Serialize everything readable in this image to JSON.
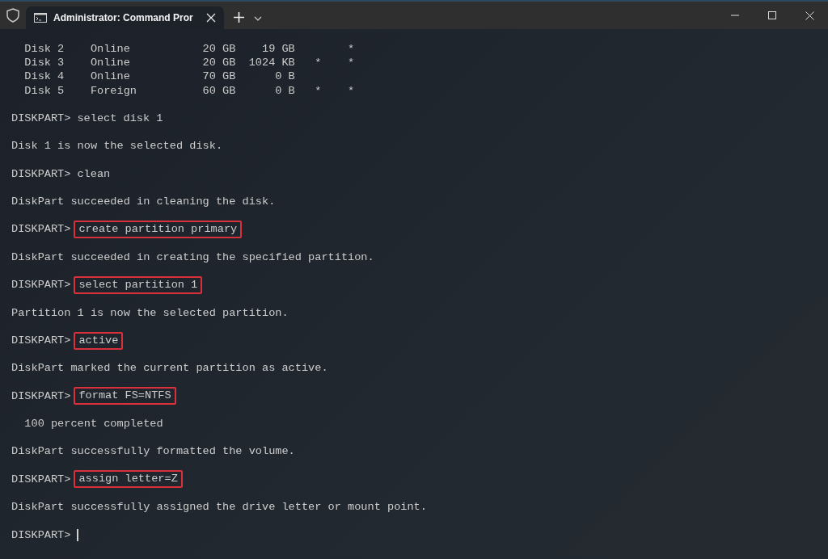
{
  "window": {
    "tabs": [
      {
        "title": "Administrator: Command Pror",
        "selected": true
      }
    ]
  },
  "terminal": {
    "lines": [
      {
        "kind": "output",
        "text": "  Disk 2    Online           20 GB    19 GB        *"
      },
      {
        "kind": "output",
        "text": "  Disk 3    Online           20 GB  1024 KB   *    *"
      },
      {
        "kind": "output",
        "text": "  Disk 4    Online           70 GB      0 B"
      },
      {
        "kind": "output",
        "text": "  Disk 5    Foreign          60 GB      0 B   *    *"
      },
      {
        "kind": "blank"
      },
      {
        "kind": "prompt",
        "prompt": "DISKPART>",
        "command": "select disk 1",
        "highlighted": false
      },
      {
        "kind": "blank"
      },
      {
        "kind": "output",
        "text": "Disk 1 is now the selected disk."
      },
      {
        "kind": "blank"
      },
      {
        "kind": "prompt",
        "prompt": "DISKPART>",
        "command": "clean",
        "highlighted": false
      },
      {
        "kind": "blank"
      },
      {
        "kind": "output",
        "text": "DiskPart succeeded in cleaning the disk."
      },
      {
        "kind": "blank"
      },
      {
        "kind": "prompt",
        "prompt": "DISKPART>",
        "command": "create partition primary",
        "highlighted": true
      },
      {
        "kind": "blank"
      },
      {
        "kind": "output",
        "text": "DiskPart succeeded in creating the specified partition."
      },
      {
        "kind": "blank"
      },
      {
        "kind": "prompt",
        "prompt": "DISKPART>",
        "command": "select partition 1",
        "highlighted": true
      },
      {
        "kind": "blank"
      },
      {
        "kind": "output",
        "text": "Partition 1 is now the selected partition."
      },
      {
        "kind": "blank"
      },
      {
        "kind": "prompt",
        "prompt": "DISKPART>",
        "command": "active",
        "highlighted": true
      },
      {
        "kind": "blank"
      },
      {
        "kind": "output",
        "text": "DiskPart marked the current partition as active."
      },
      {
        "kind": "blank"
      },
      {
        "kind": "prompt",
        "prompt": "DISKPART>",
        "command": "format FS=NTFS",
        "highlighted": true
      },
      {
        "kind": "blank"
      },
      {
        "kind": "output",
        "text": "  100 percent completed"
      },
      {
        "kind": "blank"
      },
      {
        "kind": "output",
        "text": "DiskPart successfully formatted the volume."
      },
      {
        "kind": "blank"
      },
      {
        "kind": "prompt",
        "prompt": "DISKPART>",
        "command": "assign letter=Z",
        "highlighted": true
      },
      {
        "kind": "blank"
      },
      {
        "kind": "output",
        "text": "DiskPart successfully assigned the drive letter or mount point."
      },
      {
        "kind": "blank"
      },
      {
        "kind": "prompt",
        "prompt": "DISKPART>",
        "cursor": true
      }
    ]
  }
}
